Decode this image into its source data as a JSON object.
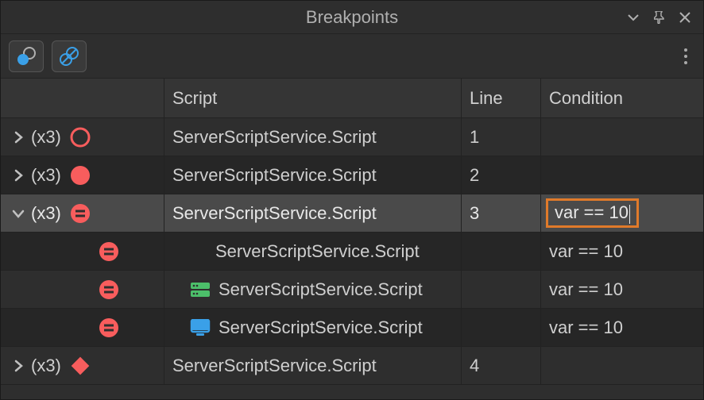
{
  "title": "Breakpoints",
  "columns": {
    "script": "Script",
    "line": "Line",
    "condition": "Condition"
  },
  "colors": {
    "breakpoint_red": "#f85d5d",
    "accent_orange": "#e07a2a",
    "server_green": "#4cbf6a",
    "client_blue": "#3aa0e8"
  },
  "rows": [
    {
      "kind": "group",
      "expanded": false,
      "count": "(x3)",
      "bp_icon": "circle-outline",
      "script": "ServerScriptService.Script",
      "line": "1",
      "condition": "",
      "selected": false,
      "indent": 0,
      "context_icon": ""
    },
    {
      "kind": "group",
      "expanded": false,
      "count": "(x3)",
      "bp_icon": "circle-filled",
      "script": "ServerScriptService.Script",
      "line": "2",
      "condition": "",
      "selected": false,
      "indent": 0,
      "context_icon": ""
    },
    {
      "kind": "group",
      "expanded": true,
      "count": "(x3)",
      "bp_icon": "circle-equals",
      "script": "ServerScriptService.Script",
      "line": "3",
      "condition": "var == 10",
      "condition_editing": true,
      "selected": true,
      "indent": 0,
      "context_icon": ""
    },
    {
      "kind": "child",
      "expanded": false,
      "count": "",
      "bp_icon": "circle-equals",
      "script": "ServerScriptService.Script",
      "line": "",
      "condition": "var == 10",
      "selected": false,
      "indent": 1,
      "context_icon": ""
    },
    {
      "kind": "child",
      "expanded": false,
      "count": "",
      "bp_icon": "circle-equals",
      "script": "ServerScriptService.Script",
      "line": "",
      "condition": "var == 10",
      "selected": false,
      "indent": 1,
      "context_icon": "server"
    },
    {
      "kind": "child",
      "expanded": false,
      "count": "",
      "bp_icon": "circle-equals",
      "script": "ServerScriptService.Script",
      "line": "",
      "condition": "var == 10",
      "selected": false,
      "indent": 1,
      "context_icon": "client"
    },
    {
      "kind": "group",
      "expanded": false,
      "count": "(x3)",
      "bp_icon": "diamond-filled",
      "script": "ServerScriptService.Script",
      "line": "4",
      "condition": "",
      "selected": false,
      "indent": 0,
      "context_icon": ""
    }
  ]
}
